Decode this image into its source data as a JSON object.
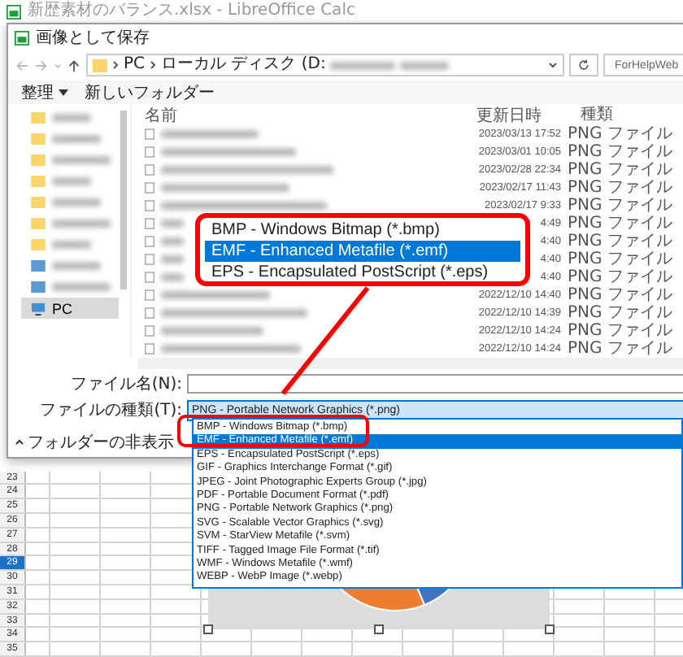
{
  "app_title": "新歴素材のバランス.xlsx - LibreOffice Calc",
  "sheet": {
    "rows": [
      {
        "label": "23",
        "selected": false
      },
      {
        "label": "24",
        "selected": false
      },
      {
        "label": "25",
        "selected": false
      },
      {
        "label": "26",
        "selected": false
      },
      {
        "label": "27",
        "selected": false
      },
      {
        "label": "28",
        "selected": false
      },
      {
        "label": "29",
        "selected": true
      },
      {
        "label": "30",
        "selected": false
      },
      {
        "label": "31",
        "selected": false
      },
      {
        "label": "32",
        "selected": false
      },
      {
        "label": "33",
        "selected": false
      },
      {
        "label": "34",
        "selected": false
      },
      {
        "label": "35",
        "selected": false
      }
    ]
  },
  "dialog": {
    "title": "画像として保存",
    "path": [
      "PC",
      "ローカル ディスク (D:"
    ],
    "search": {
      "placeholder": "ForHelpWeb"
    },
    "toolbar": [
      {
        "label": "整理",
        "kind": "menu"
      },
      {
        "label": "新しいフォルダー",
        "kind": "button"
      }
    ],
    "nav": [
      {
        "label": "PC",
        "selected": true
      }
    ],
    "columns": [
      "名前",
      "更新日時",
      "種類"
    ],
    "files": [
      {
        "modified": "2023/03/13 17:52",
        "type": "PNG ファイル"
      },
      {
        "modified": "2023/03/01 10:05",
        "type": "PNG ファイル"
      },
      {
        "modified": "2023/02/28 22:34",
        "type": "PNG ファイル"
      },
      {
        "modified": "2023/02/17 11:43",
        "type": "PNG ファイル"
      },
      {
        "modified": "2023/02/17 9:33",
        "type": "PNG ファイル"
      },
      {
        "modified": "4:49",
        "type": "PNG ファイル"
      },
      {
        "modified": "4:40",
        "type": "PNG ファイル"
      },
      {
        "modified": "4:40",
        "type": "PNG ファイル"
      },
      {
        "modified": "4:40",
        "type": "PNG ファイル"
      },
      {
        "modified": "2022/12/10 14:40",
        "type": "PNG ファイル"
      },
      {
        "modified": "2022/12/10 14:39",
        "type": "PNG ファイル"
      },
      {
        "modified": "2022/12/10 14:24",
        "type": "PNG ファイル"
      },
      {
        "modified": "2022/12/10 14:24",
        "type": "PNG ファイル"
      }
    ],
    "file_name": {
      "label": "ファイル名(N):"
    },
    "file_type": {
      "label": "ファイルの種類(T):",
      "value": "PNG - Portable Network Graphics (*.png)"
    },
    "folder_toggle": "フォルダーの非表示"
  },
  "type_list": [
    {
      "label": "BMP - Windows Bitmap (*.bmp)",
      "selected": false
    },
    {
      "label": "EMF - Enhanced Metafile (*.emf)",
      "selected": true
    },
    {
      "label": "EPS - Encapsulated PostScript (*.eps)",
      "selected": false
    },
    {
      "label": "GIF - Graphics Interchange Format (*.gif)",
      "selected": false
    },
    {
      "label": "JPEG - Joint Photographic Experts Group (*.jpg)",
      "selected": false
    },
    {
      "label": "PDF - Portable Document Format (*.pdf)",
      "selected": false
    },
    {
      "label": "PNG - Portable Network Graphics (*.png)",
      "selected": false
    },
    {
      "label": "SVG - Scalable Vector Graphics (*.svg)",
      "selected": false
    },
    {
      "label": "SVM - StarView Metafile (*.svm)",
      "selected": false
    },
    {
      "label": "TIFF - Tagged Image File Format (*.tif)",
      "selected": false
    },
    {
      "label": "WMF - Windows Metafile (*.wmf)",
      "selected": false
    },
    {
      "label": "WEBP - WebP Image (*.webp)",
      "selected": false
    }
  ],
  "callout": {
    "items": [
      {
        "label": "BMP - Windows Bitmap (*.bmp)",
        "selected": false
      },
      {
        "label": "EMF - Enhanced Metafile (*.emf)",
        "selected": true
      },
      {
        "label": "EPS - Encapsulated PostScript (*.eps)",
        "selected": false
      }
    ]
  }
}
